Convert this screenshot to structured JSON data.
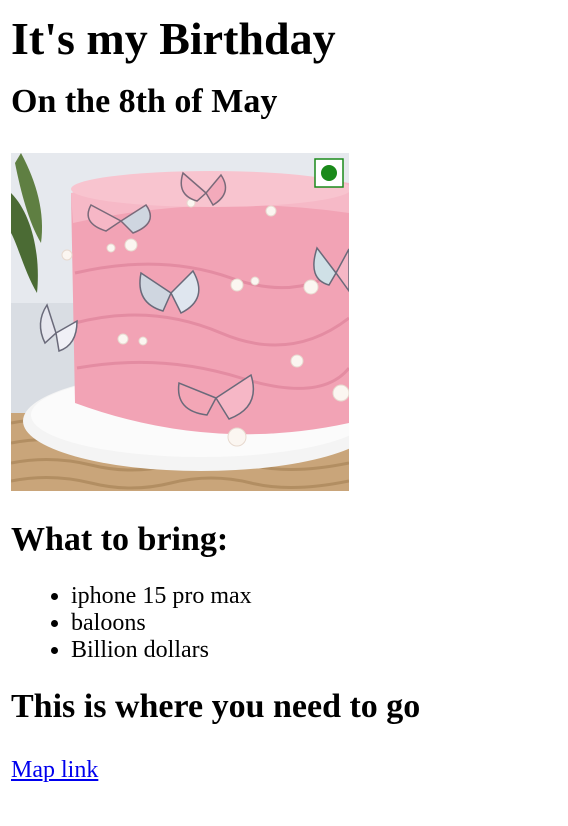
{
  "page": {
    "title": "It's my Birthday",
    "date_heading": "On the 8th of May",
    "image": {
      "subject": "pink birthday cake with butterflies and pearls",
      "badge": "green-dot-icon",
      "colors": {
        "cake": "#f2a3b5",
        "butterflies": "#f6b7c6",
        "plate": "#f2f2f2",
        "badge_dot": "#1a8a1a"
      }
    },
    "bring_heading": "What to bring:",
    "bring_items": [
      "iphone 15 pro max",
      "baloons",
      "Billion dollars"
    ],
    "go_heading": "This is where you need to go",
    "map_link_label": "Map link",
    "link_color": "#0000ee"
  }
}
